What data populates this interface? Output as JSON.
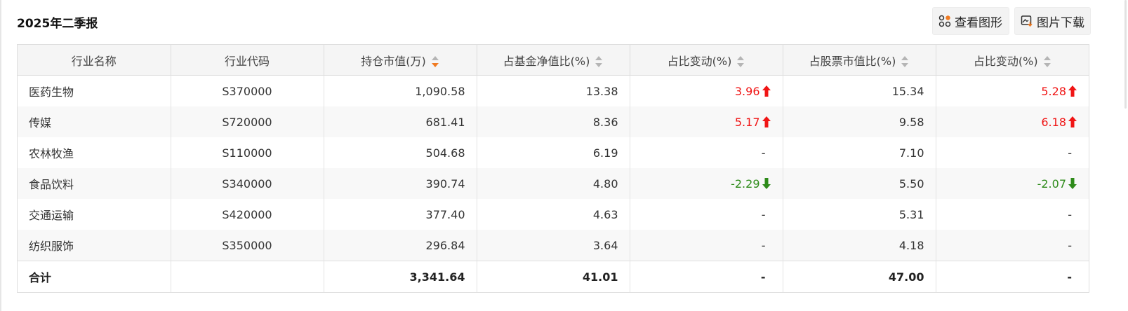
{
  "title": "2025年二季报",
  "buttons": {
    "chart": "查看图形",
    "download": "图片下载"
  },
  "colors": {
    "up": "#f01515",
    "down": "#2e8b1a",
    "sort_active": "#f07b22"
  },
  "table": {
    "headers": [
      "行业名称",
      "行业代码",
      "持仓市值(万)",
      "占基金净值比(%)",
      "占比变动(%)",
      "占股票市值比(%)",
      "占比变动(%)"
    ],
    "active_sort_column": "持仓市值(万)",
    "rows": [
      {
        "name": "医药生物",
        "code": "S370000",
        "value": "1,090.58",
        "nav_pct": "13.38",
        "nav_change": "3.96",
        "nav_dir": "up",
        "stock_pct": "15.34",
        "stock_change": "5.28",
        "stock_dir": "up"
      },
      {
        "name": "传媒",
        "code": "S720000",
        "value": "681.41",
        "nav_pct": "8.36",
        "nav_change": "5.17",
        "nav_dir": "up",
        "stock_pct": "9.58",
        "stock_change": "6.18",
        "stock_dir": "up"
      },
      {
        "name": "农林牧渔",
        "code": "S110000",
        "value": "504.68",
        "nav_pct": "6.19",
        "nav_change": "-",
        "nav_dir": "none",
        "stock_pct": "7.10",
        "stock_change": "-",
        "stock_dir": "none"
      },
      {
        "name": "食品饮料",
        "code": "S340000",
        "value": "390.74",
        "nav_pct": "4.80",
        "nav_change": "-2.29",
        "nav_dir": "down",
        "stock_pct": "5.50",
        "stock_change": "-2.07",
        "stock_dir": "down"
      },
      {
        "name": "交通运输",
        "code": "S420000",
        "value": "377.40",
        "nav_pct": "4.63",
        "nav_change": "-",
        "nav_dir": "none",
        "stock_pct": "5.31",
        "stock_change": "-",
        "stock_dir": "none"
      },
      {
        "name": "纺织服饰",
        "code": "S350000",
        "value": "296.84",
        "nav_pct": "3.64",
        "nav_change": "-",
        "nav_dir": "none",
        "stock_pct": "4.18",
        "stock_change": "-",
        "stock_dir": "none"
      }
    ],
    "total": {
      "label": "合计",
      "code": "",
      "value": "3,341.64",
      "nav_pct": "41.01",
      "nav_change": "-",
      "stock_pct": "47.00",
      "stock_change": "-"
    }
  }
}
